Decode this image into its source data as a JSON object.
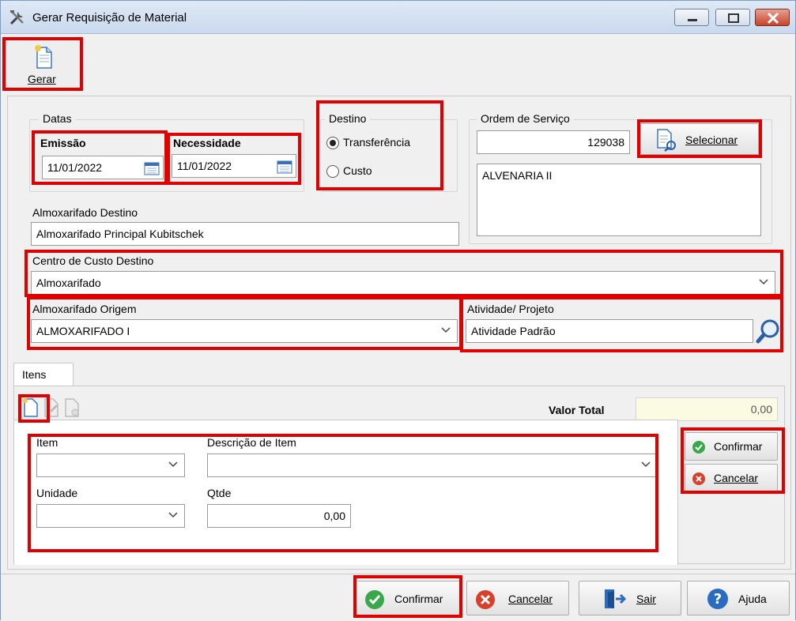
{
  "window": {
    "title": "Gerar Requisição de Material"
  },
  "toolbar": {
    "gerar_label": "Gerar"
  },
  "datas": {
    "group_label": "Datas",
    "emissao_label": "Emissão",
    "emissao_value": "11/01/2022",
    "necessidade_label": "Necessidade",
    "necessidade_value": "11/01/2022"
  },
  "destino": {
    "group_label": "Destino",
    "options": [
      "Transferência",
      "Custo"
    ],
    "selected": "Transferência"
  },
  "ordem_servico": {
    "group_label": "Ordem de Serviço",
    "number": "129038",
    "selecionar_label": "Selecionar",
    "description": "ALVENARIA II"
  },
  "almoxarifado_destino": {
    "label": "Almoxarifado Destino",
    "value": "Almoxarifado Principal Kubitschek"
  },
  "centro_custo": {
    "label": "Centro de Custo Destino",
    "value": "Almoxarifado"
  },
  "almoxarifado_origem": {
    "label": "Almoxarifado Origem",
    "value": "ALMOXARIFADO I"
  },
  "atividade": {
    "label": "Atividade/ Projeto",
    "value": "Atividade Padrão"
  },
  "itens": {
    "tab_label": "Itens",
    "valor_total_label": "Valor Total",
    "valor_total_value": "0,00",
    "item_label": "Item",
    "item_value": "",
    "descricao_label": "Descrição de Item",
    "descricao_value": "",
    "unidade_label": "Unidade",
    "unidade_value": "",
    "qtde_label": "Qtde",
    "qtde_value": "0,00",
    "confirmar_label": "Confirmar",
    "cancelar_label": "Cancelar"
  },
  "footer": {
    "confirmar_label": "Confirmar",
    "cancelar_label": "Cancelar",
    "sair_label": "Sair",
    "ajuda_label": "Ajuda"
  },
  "colors": {
    "highlight": "#e00000",
    "confirm_green": "#3aa84a",
    "cancel_red": "#d8402c",
    "help_blue": "#2a6dc0",
    "total_field_bg": "#fbfbe3"
  }
}
